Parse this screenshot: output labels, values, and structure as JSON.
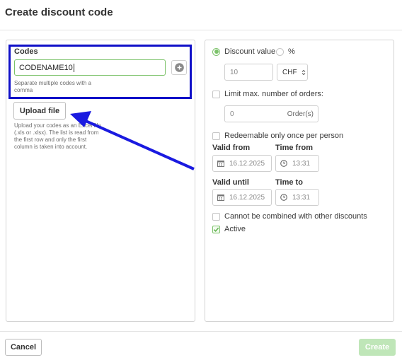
{
  "title": "Create discount code",
  "codes": {
    "label": "Codes",
    "value": "CODENAME10",
    "hint_line1": "Separate multiple codes with a",
    "hint_line2": "comma"
  },
  "upload": {
    "button": "Upload file",
    "hint": [
      "Upload your codes as an Excel file",
      "(.xls or .xlsx). The list is read from",
      "the first row and only the first",
      "column is taken into account."
    ]
  },
  "discount": {
    "value_label": "Discount value",
    "percent_label": "%",
    "amount_placeholder": "10",
    "currency": "CHF",
    "selected": "value"
  },
  "limit_orders": {
    "label": "Limit max. number of orders:",
    "placeholder": "0",
    "unit": "Order(s)",
    "checked": false
  },
  "redeem_once": {
    "label": "Redeemable only once per person",
    "checked": false
  },
  "valid_from": {
    "label": "Valid from",
    "date": "16.12.2025"
  },
  "time_from": {
    "label": "Time from",
    "time": "13:31"
  },
  "valid_until": {
    "label": "Valid until",
    "date": "16.12.2025"
  },
  "time_to": {
    "label": "Time to",
    "time": "13:31"
  },
  "no_combine": {
    "label": "Cannot be combined with other discounts",
    "checked": false
  },
  "active": {
    "label": "Active",
    "checked": true
  },
  "footer": {
    "cancel": "Cancel",
    "create": "Create"
  },
  "colors": {
    "accent_green": "#7cc26a",
    "create_disabled": "#bfe6b8",
    "highlight_box": "#1010c8",
    "arrow": "#1a1ae0"
  }
}
